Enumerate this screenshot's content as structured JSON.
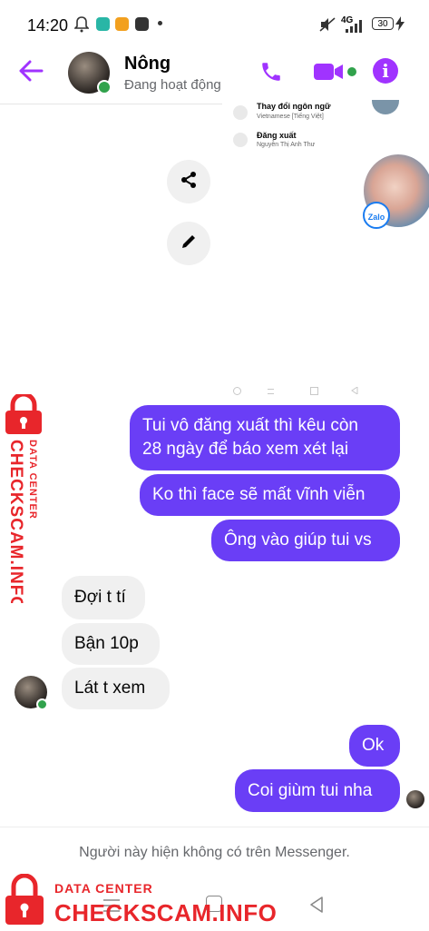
{
  "status_bar": {
    "time": "14:20",
    "network": "4G",
    "battery": "30"
  },
  "header": {
    "contact_name": "Nông",
    "contact_status": "Đang hoạt động",
    "icons": [
      "back-arrow-icon",
      "phone-icon",
      "video-icon",
      "info-icon"
    ]
  },
  "shared_screenshot": {
    "menu_items": [
      {
        "title": "Thay đổi ngôn ngữ",
        "subtitle": "Vietnamese [Tiếng Việt]"
      },
      {
        "title": "Đăng xuất",
        "subtitle": "Nguyễn Thị Anh Thư"
      }
    ],
    "zalo_label": "Zalo"
  },
  "messages": [
    {
      "side": "out",
      "text": "Tui vô đăng xuất thì kêu còn\n28 ngày để báo xem xét lại"
    },
    {
      "side": "out",
      "text": "Ko thì face sẽ mất vĩnh viễn"
    },
    {
      "side": "out",
      "text": "Ông vào giúp tui vs"
    },
    {
      "side": "in",
      "text": "Đợi t tí"
    },
    {
      "side": "in",
      "text": "Bận 10p"
    },
    {
      "side": "in",
      "text": "Lát t xem"
    },
    {
      "side": "out",
      "text": "Ok"
    },
    {
      "side": "out",
      "text": "Coi giùm tui nha"
    }
  ],
  "footer_notice": "Người này hiện không có trên Messenger.",
  "watermark": {
    "top_label": "DATA CENTER",
    "brand": "CHECKSCAM.INFO"
  },
  "colors": {
    "accent": "#a033ff",
    "outgoing": "#6a3ef6",
    "incoming": "#f0f0f0",
    "online": "#31a24c",
    "watermark": "#e8262b"
  }
}
